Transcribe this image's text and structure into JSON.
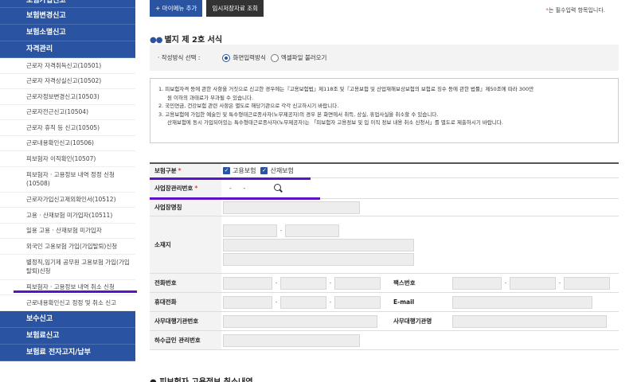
{
  "sidebar": {
    "categories_top": [
      "보험가입신고",
      "보험변경신고",
      "보험소멸신고",
      "자격관리"
    ],
    "items": [
      "근로자 자격취득신고(10501)",
      "근로자 자격상실신고(10502)",
      "근로자정보변경신고(10503)",
      "근로자전근신고(10504)",
      "근로자 휴직 등 신고(10505)",
      "근로내용확인신고(10506)",
      "피보험자 이직확인(10507)",
      "피보험자 · 고용정보 내역 정정 신청(10508)",
      "근로자가입신고제외확인서(10512)",
      "고용 · 산재보험 미가입자(10511)",
      "일용 고용 · 산재보험 미가입자",
      "외국인 고용보험 가입(가입탈퇴)신청",
      "별정직,임기제 공무원 고용보험 가입(가입탈퇴)신청",
      "피보험자 · 고용정보 내역 취소 신청",
      "근로내용확인신고 정정 및 취소 신고"
    ],
    "categories_bottom": [
      "보수신고",
      "보험료신고",
      "보험료 전자고지/납부"
    ]
  },
  "toolbar": {
    "my_menu_label": "+ 마이메뉴 추가",
    "temp_save_label": "임시저장자료 조회",
    "required_note_star": "*",
    "required_note": "는 필수입력 항목입니다."
  },
  "section": {
    "dots": "●●",
    "title": "별지 제 2호 서식",
    "bottom_title": "● 피보험자 고용정보 취소내역"
  },
  "method": {
    "label": "· 작성방식 선택 :",
    "option_screen": "화면입력방식",
    "option_excel": "엑셀파일 불러오기",
    "selected": "화면입력방식"
  },
  "notice": {
    "line1": "1. 피보험자격 등에 관한 사항을 거짓으로 신고한 경우에는『고용보험법』제118조 및『고용보험 및 산업재해보상보험의 보험료 징수 등에 관한 법률』제50조에 따라 300만",
    "line1b": "원 이하의 과태료가 부과될 수 있습니다.",
    "line2": "2. 국민연금, 건강보험 관련 사항은 별도로 해당기관으로 각각 신고하시기 바랍니다.",
    "line3": "3. 고용보험에 가입한 예술인 및 특수형태근로종사자(노무제공자)의 경우 본 화면에서 취득, 상실, 휴업사실을 취소할 수 있습니다.",
    "line3b": "산재보험에 동시 가입되어있는 특수형태근로종사자(노무제공자)는 「피보험자 고용정보 및 입 이직 정보 내용 취소 신청서」를 별도로 제출하시기 바랍니다."
  },
  "form": {
    "insurance_type_label": "보험구분",
    "required_star": "*",
    "employment_insurance": "고용보험",
    "industrial_insurance": "산재보험",
    "business_no_label": "사업장관리번호",
    "business_no_value": "- -",
    "business_name_label": "사업장명칭",
    "address_label": "소재지",
    "address_dash": "-",
    "phone_label": "전화번호",
    "fax_label": "팩스번호",
    "mobile_label": "휴대전화",
    "email_label": "E-mail",
    "agent_no_label": "사무대행기관번호",
    "agent_name_label": "사무대행기관명",
    "subcontract_label": "하수급인 관리번호",
    "dash": "-"
  },
  "colors": {
    "brand_blue": "#2a54a1",
    "highlight_purple": "#5b12c9",
    "required_red": "#d9443b"
  }
}
